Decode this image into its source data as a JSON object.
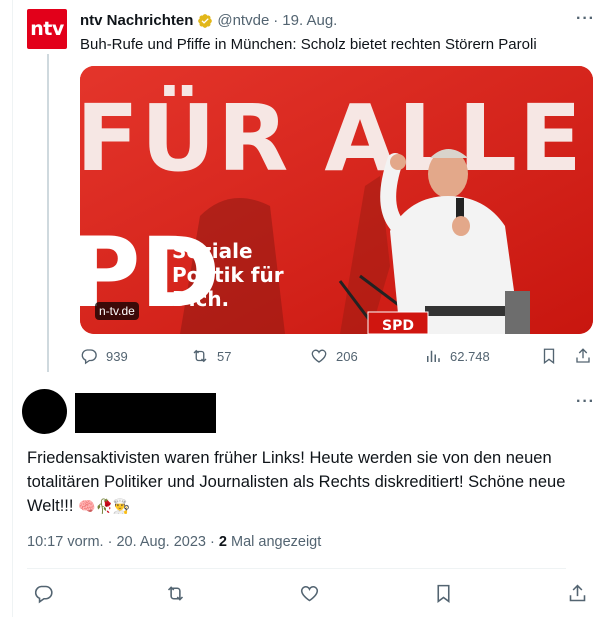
{
  "tweet": {
    "author_name": "ntv Nachrichten",
    "avatar_text": "ntv",
    "handle": "@ntvde",
    "separator": "·",
    "date": "19. Aug.",
    "text": "Buh-Rufe und Pfiffe in München: Scholz bietet rechten Störern Paroli",
    "image": {
      "banner_text": "FÜR ALLE.",
      "side_text_1": "Soziale",
      "side_text_2": "Politik für",
      "side_text_3": "Dich.",
      "party_text": "PD",
      "podium_text": "SPD",
      "source_badge": "n-tv.de"
    },
    "stats": {
      "replies": "939",
      "retweets": "57",
      "likes": "206",
      "views": "62.748"
    }
  },
  "reply": {
    "text": "Friedensaktivisten waren früher Links! Heute werden sie von den neuen totalitären Politiker und Journalisten als Rechts diskreditiert! Schöne neue Welt!!!",
    "emojis": "🧠🥀👨‍🍳",
    "time": "10:17 vorm.",
    "separator": "·",
    "date": "20. Aug. 2023",
    "separator2": "·",
    "view_count": "2",
    "view_label": "Mal angezeigt"
  },
  "colors": {
    "brand_red": "#e2001a",
    "muted_text": "#536471",
    "primary_text": "#0f1419",
    "verified_gold": "#e2b719"
  },
  "icons": [
    "reply-icon",
    "retweet-icon",
    "like-icon",
    "views-icon",
    "bookmark-icon",
    "share-icon",
    "verified-badge-icon",
    "more-icon"
  ]
}
